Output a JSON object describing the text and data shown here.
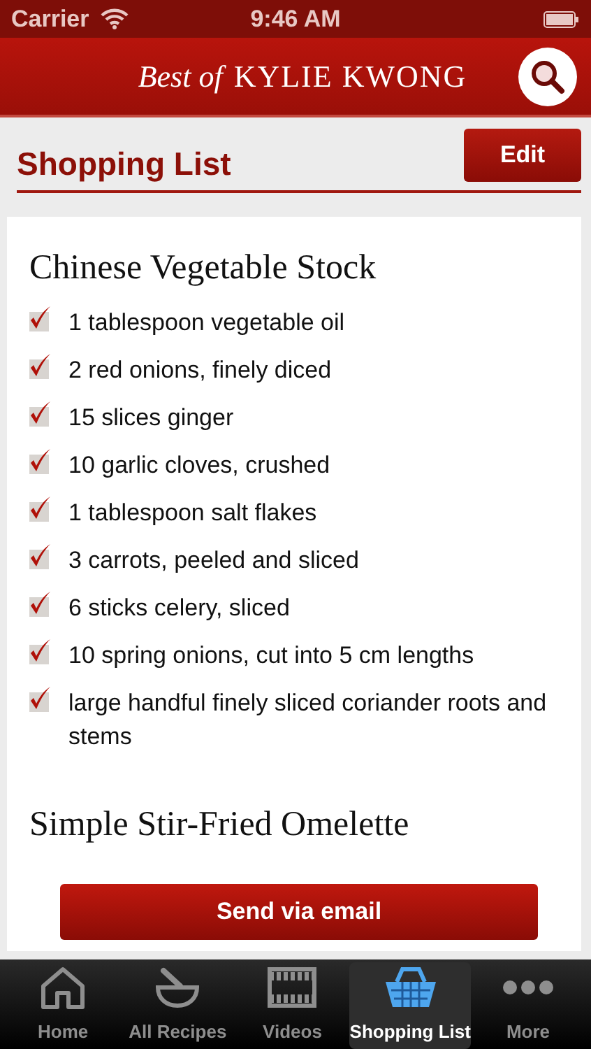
{
  "status_bar": {
    "carrier": "Carrier",
    "time": "9:46 AM"
  },
  "header": {
    "logo_script": "Best of",
    "logo_name": "KYLIE KWONG"
  },
  "page": {
    "title": "Shopping List",
    "edit_button": "Edit"
  },
  "recipes": [
    {
      "title": "Chinese Vegetable Stock",
      "ingredients": [
        {
          "text": "1 tablespoon vegetable oil",
          "checked": true
        },
        {
          "text": "2 red onions, finely diced",
          "checked": true
        },
        {
          "text": "15 slices ginger",
          "checked": true
        },
        {
          "text": "10 garlic cloves, crushed",
          "checked": true
        },
        {
          "text": "1 tablespoon salt flakes",
          "checked": true
        },
        {
          "text": "3 carrots, peeled and sliced",
          "checked": true
        },
        {
          "text": "6 sticks celery, sliced",
          "checked": true
        },
        {
          "text": "10 spring onions, cut into 5 cm lengths",
          "checked": true
        },
        {
          "text": "large handful finely sliced coriander roots and stems",
          "checked": true
        }
      ]
    },
    {
      "title": "Simple Stir-Fried Omelette"
    }
  ],
  "send_button": "Send via email",
  "tabs": [
    {
      "label": "Home",
      "kind": "home",
      "selected": false
    },
    {
      "label": "All Recipes",
      "kind": "bowl",
      "selected": false
    },
    {
      "label": "Videos",
      "kind": "film",
      "selected": false
    },
    {
      "label": "Shopping List",
      "kind": "basket",
      "selected": true
    },
    {
      "label": "More",
      "kind": "more",
      "selected": false
    }
  ]
}
